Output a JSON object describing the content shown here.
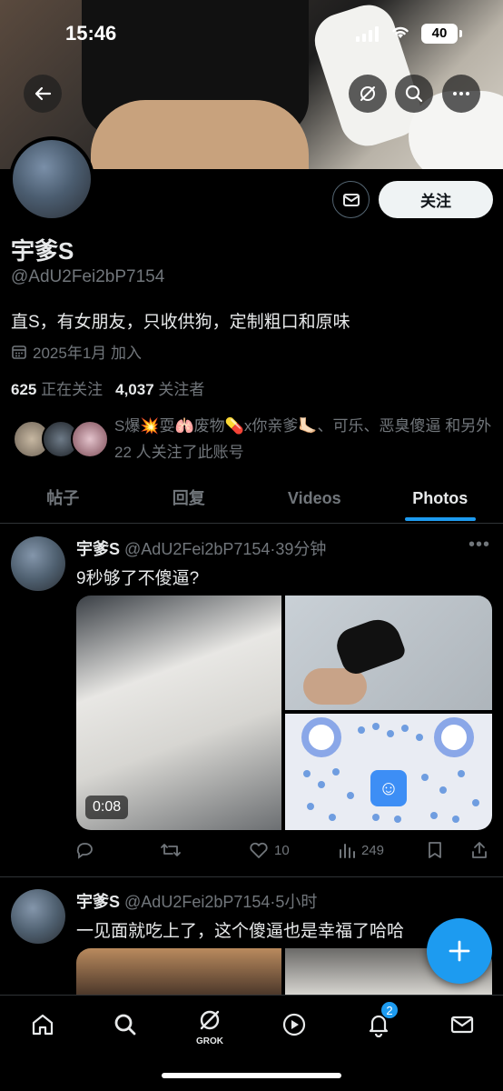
{
  "status_bar": {
    "time": "15:46",
    "battery": "40"
  },
  "profile": {
    "display_name": "宇爹S",
    "handle": "@AdU2Fei2bP7154",
    "bio": "直S，有女朋友，只收供狗，定制粗口和原味",
    "joined": "2025年1月 加入",
    "following_count": "625",
    "following_label": "正在关注",
    "followers_count": "4,037",
    "followers_label": "关注者",
    "follow_button": "关注",
    "followed_by": "S爆💥耍🫁废物💊x你亲爹🦶🏻、可乐、恶臭傻逼 和另外 22 人关注了此账号"
  },
  "tabs": [
    {
      "label": "帖子"
    },
    {
      "label": "回复"
    },
    {
      "label": "Videos"
    },
    {
      "label": "Photos",
      "active": true
    }
  ],
  "posts": [
    {
      "name": "宇爹S",
      "handle": "@AdU2Fei2bP7154",
      "time": "39分钟",
      "text": "9秒够了不傻逼?",
      "video_duration": "0:08",
      "likes": "10",
      "views": "249"
    },
    {
      "name": "宇爹S",
      "handle": "@AdU2Fei2bP7154",
      "time": "5小时",
      "text": "一见面就吃上了，这个傻逼也是幸福了哈哈"
    }
  ],
  "nav": {
    "grok_label": "GROK",
    "notifications_badge": "2"
  },
  "colors": {
    "accent": "#1d9bf0",
    "background": "#000000",
    "muted": "#71767b"
  }
}
